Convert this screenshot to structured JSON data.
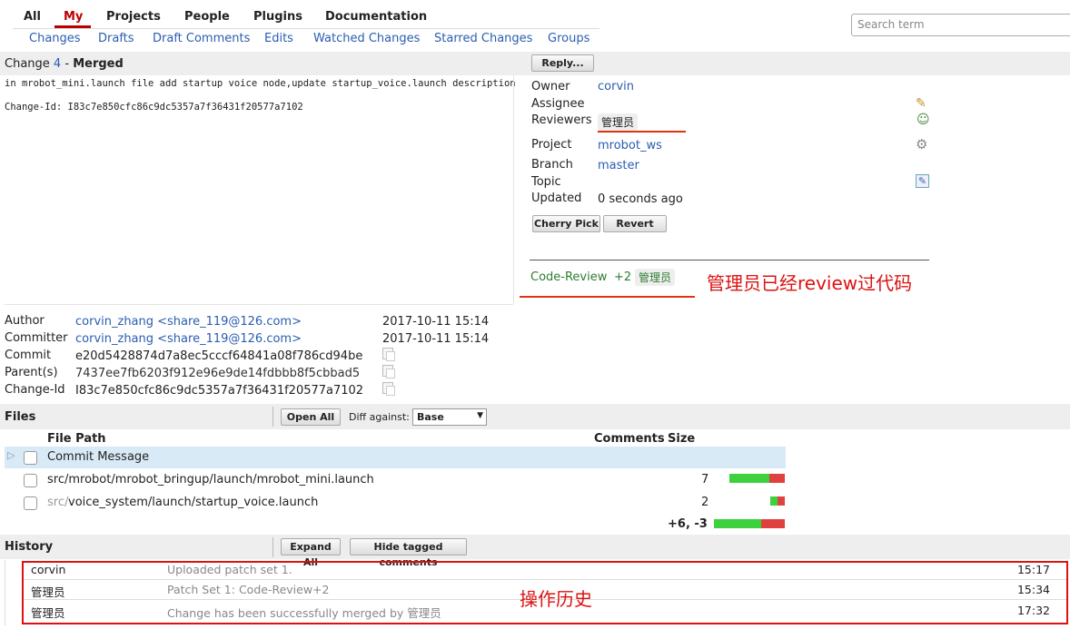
{
  "nav": {
    "tabs": [
      "All",
      "My",
      "Projects",
      "People",
      "Plugins",
      "Documentation"
    ],
    "subtabs": [
      "Changes",
      "Drafts",
      "Draft Comments",
      "Edits",
      "Watched Changes",
      "Starred Changes",
      "Groups"
    ],
    "search_placeholder": "Search term"
  },
  "change": {
    "title_prefix": "Change",
    "number": "4",
    "separator": "-",
    "status": "Merged",
    "reply_label": "Reply...",
    "message_line1": "in mrobot_mini.launch file add startup voice node,update startup_voice.launch description",
    "message_line2": "Change-Id: I83c7e850cfc86c9dc5357a7f36431f20577a7102"
  },
  "info": {
    "owner_label": "Owner",
    "owner": "corvin",
    "assignee_label": "Assignee",
    "reviewers_label": "Reviewers",
    "reviewer": "管理员",
    "project_label": "Project",
    "project": "mrobot_ws",
    "branch_label": "Branch",
    "branch": "master",
    "topic_label": "Topic",
    "updated_label": "Updated",
    "updated": "0 seconds ago",
    "cherry_pick_label": "Cherry Pick",
    "revert_label": "Revert"
  },
  "review": {
    "label": "Code-Review",
    "score": "+2",
    "user": "管理员",
    "annotation": "管理员已经review过代码"
  },
  "commit": {
    "author_label": "Author",
    "author": "corvin_zhang <share_119@126.com>",
    "author_date": "2017-10-11 15:14",
    "committer_label": "Committer",
    "committer": "corvin_zhang <share_119@126.com>",
    "committer_date": "2017-10-11 15:14",
    "commit_label": "Commit",
    "commit": "e20d5428874d7a8ec5cccf64841a08f786cd94be",
    "parent_label": "Parent(s)",
    "parent": "7437ee7fb6203f912e96e9de14fdbbb8f5cbbad5",
    "changeid_label": "Change-Id",
    "changeid": "I83c7e850cfc86c9dc5357a7f36431f20577a7102"
  },
  "files": {
    "section_label": "Files",
    "open_all_label": "Open All",
    "diff_against_label": "Diff against:",
    "diff_against_value": "Base",
    "col_path": "File Path",
    "col_comments": "Comments",
    "col_size": "Size",
    "rows": [
      {
        "prefix": "",
        "path": "Commit Message",
        "size": ""
      },
      {
        "prefix": "",
        "path": "src/mrobot/mrobot_bringup/launch/mrobot_mini.launch",
        "size": "7"
      },
      {
        "prefix": "src/",
        "path": "voice_system/launch/startup_voice.launch",
        "size": "2"
      }
    ],
    "total": "+6, -3"
  },
  "history": {
    "section_label": "History",
    "expand_all_label": "Expand All",
    "hide_tagged_label": "Hide tagged comments",
    "annotation": "操作历史",
    "rows": [
      {
        "user": "corvin",
        "message": "Uploaded patch set 1.",
        "time": "15:17"
      },
      {
        "user": "管理员",
        "message": "Patch Set 1: Code-Review+2",
        "time": "15:34"
      },
      {
        "user": "管理员",
        "message": "Change has been successfully merged by 管理员",
        "time": "17:32"
      }
    ]
  },
  "colors": {
    "accent": "#b00000",
    "link": "#2a5db0",
    "added": "#3dd13d",
    "removed": "#e04040",
    "review": "#2e7d32",
    "annotation": "#dd1111"
  }
}
